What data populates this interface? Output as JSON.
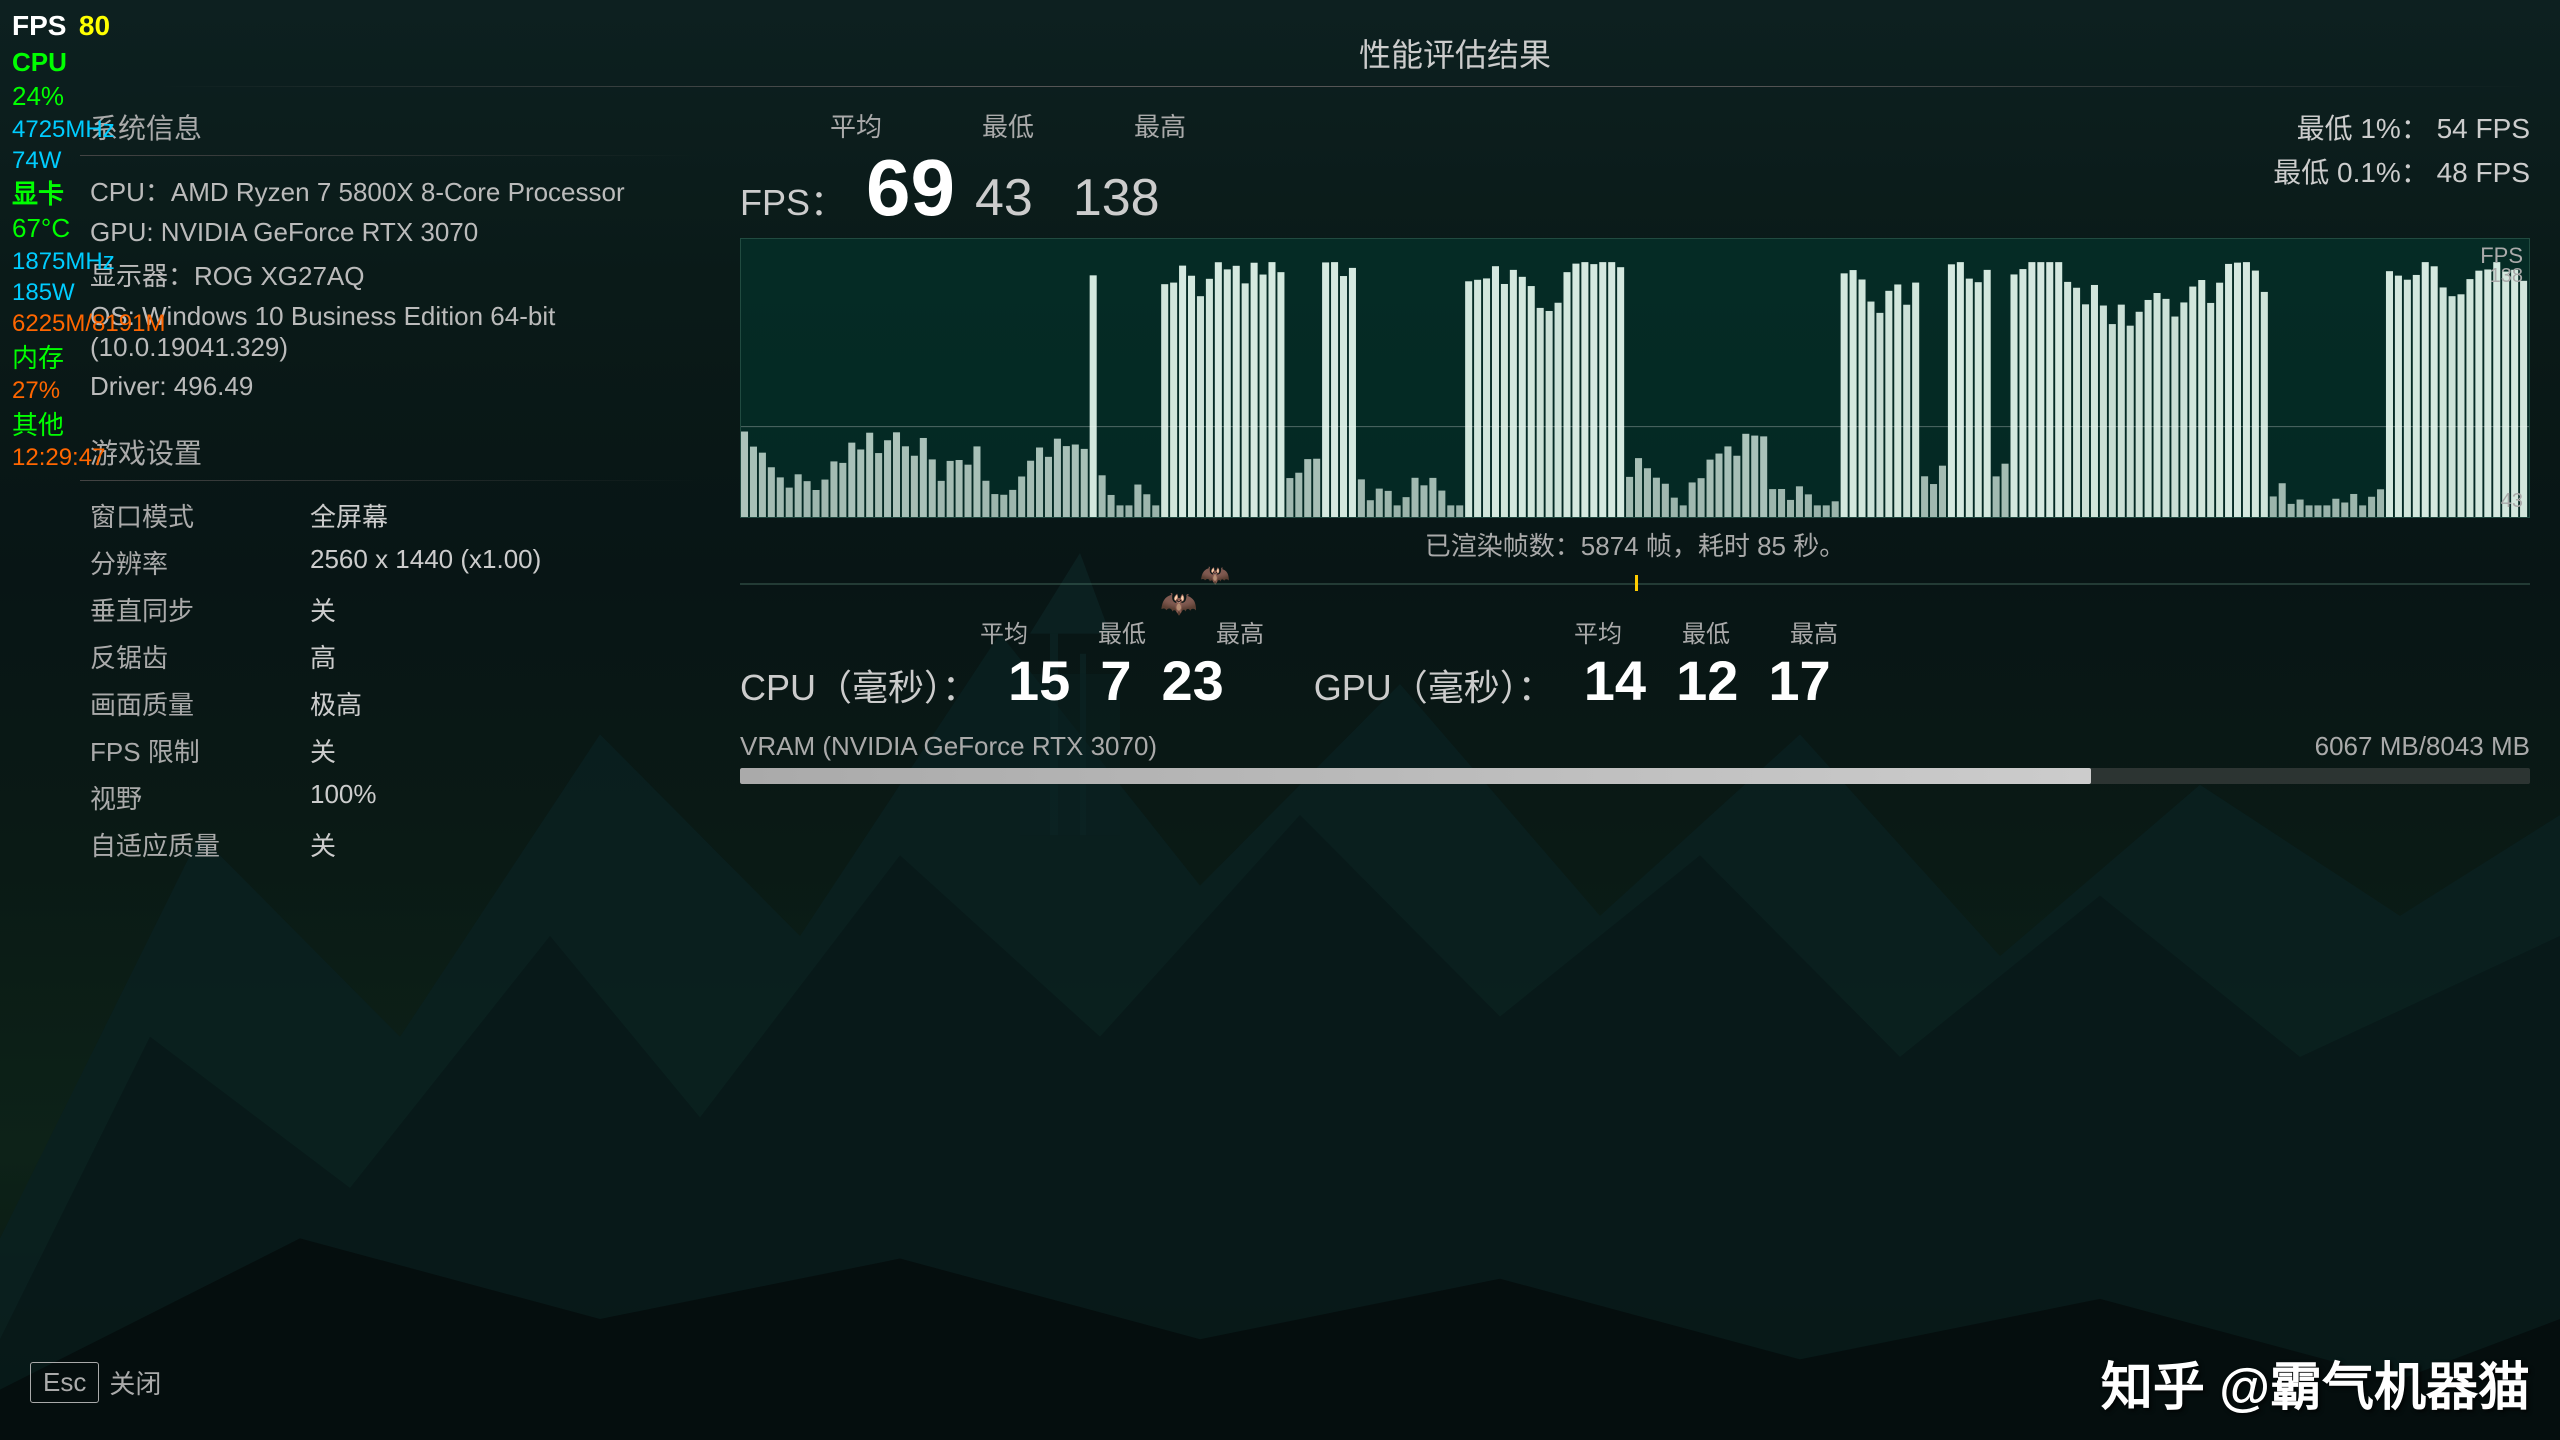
{
  "title": "性能评估结果",
  "hud": {
    "fps_label": "FPS",
    "fps_value": "80",
    "cpu_label": "CPU",
    "cpu_usage": "24%",
    "cpu_freq": "4725MHz",
    "cpu_power": "74W",
    "gpu_label": "显卡",
    "gpu_temp": "67°C",
    "gpu_freq": "1875MHz",
    "gpu_power": "185W",
    "gpu_mem": "6225M/8191M",
    "mem_label": "内存",
    "mem_usage": "27%",
    "other_label": "其他",
    "time": "12:29:47"
  },
  "system_info": {
    "section_title": "系统信息",
    "cpu": "CPU：AMD Ryzen 7 5800X 8-Core Processor",
    "gpu": "GPU: NVIDIA GeForce RTX 3070",
    "display": "显示器：ROG XG27AQ",
    "os": "OS: Windows 10 Business Edition 64-bit (10.0.19041.329)",
    "driver": "Driver: 496.49"
  },
  "game_settings": {
    "section_title": "游戏设置",
    "rows": [
      {
        "key": "窗口模式",
        "val": "全屏幕"
      },
      {
        "key": "分辨率",
        "val": "2560 x 1440 (x1.00)"
      },
      {
        "key": "垂直同步",
        "val": "关"
      },
      {
        "key": "反锯齿",
        "val": "高"
      },
      {
        "key": "画面质量",
        "val": "极高"
      },
      {
        "key": "FPS 限制",
        "val": "关"
      },
      {
        "key": "视野",
        "val": "100%"
      },
      {
        "key": "自适应质量",
        "val": "关"
      }
    ]
  },
  "fps_panel": {
    "fps_label": "FPS：",
    "avg_label": "平均",
    "min_label": "最低",
    "max_label": "最高",
    "avg_val": "69",
    "min_val": "43",
    "max_val": "138",
    "low1_label": "最低 1%：",
    "low1_val": "54 FPS",
    "low01_label": "最低 0.1%：",
    "low01_val": "48 FPS",
    "graph_max": "138",
    "graph_min": "43",
    "graph_fps_label": "FPS",
    "rendered_text": "已渲染帧数：5874 帧，耗时 85 秒。"
  },
  "cpu_ms": {
    "label": "CPU（毫秒）：",
    "avg_label": "平均",
    "min_label": "最低",
    "max_label": "最高",
    "avg_val": "15",
    "min_val": "7",
    "max_val": "23"
  },
  "gpu_ms": {
    "label": "GPU（毫秒）：",
    "avg_label": "平均",
    "min_label": "最低",
    "max_label": "最高",
    "avg_val": "14",
    "min_val": "12",
    "max_val": "17"
  },
  "vram": {
    "label": "VRAM (NVIDIA GeForce RTX 3070)",
    "current": "6067 MB/8043 MB",
    "percent": 75.5
  },
  "bottom": {
    "esc_label": "Esc",
    "close_label": "关闭",
    "watermark": "知乎 @霸气机器猫"
  }
}
